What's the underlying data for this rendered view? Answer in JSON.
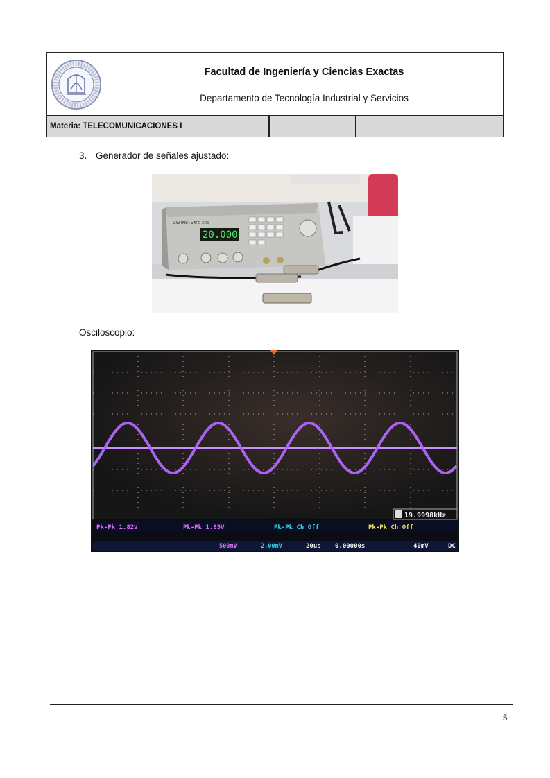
{
  "header": {
    "faculty": "Facultad de Ingeniería y Ciencias Exactas",
    "department": "Departamento de Tecnología Industrial y Servicios",
    "subject": "Materia: TELECOMUNICACIONES I",
    "logo_name": "university-seal-logo",
    "logo_text": "UNIVERSIDAD ARGENTINA DE LA EMPRESA"
  },
  "content": {
    "item_number": "3.",
    "item_text": "Generador de señales ajustado:",
    "oscilloscope_label": "Osciloscopio:"
  },
  "generator_photo": {
    "brand": "GW INSTEK",
    "model": "AFG-2105",
    "display_value": "20.000"
  },
  "oscilloscope": {
    "frequency": "19.9998kHz",
    "measure_ch1": "Pk-Pk 1.82V",
    "measure_ch2": "Pk-Pk 1.85V",
    "measure_ch3": "Pk-Pk Ch Off",
    "measure_ch4": "Pk-Pk Ch Off",
    "timebase": "20us",
    "delay": "0.00000s",
    "ch2_scale": "500mV",
    "ch3_scale": "2.00mV",
    "trigger_level": "40mV",
    "coupling": "DC",
    "colors": {
      "trace": "#b266ff",
      "ch1": "#e070ff",
      "ch3": "#40d0e0",
      "ch4": "#f0e060"
    }
  },
  "footer": {
    "page_number": "5"
  }
}
